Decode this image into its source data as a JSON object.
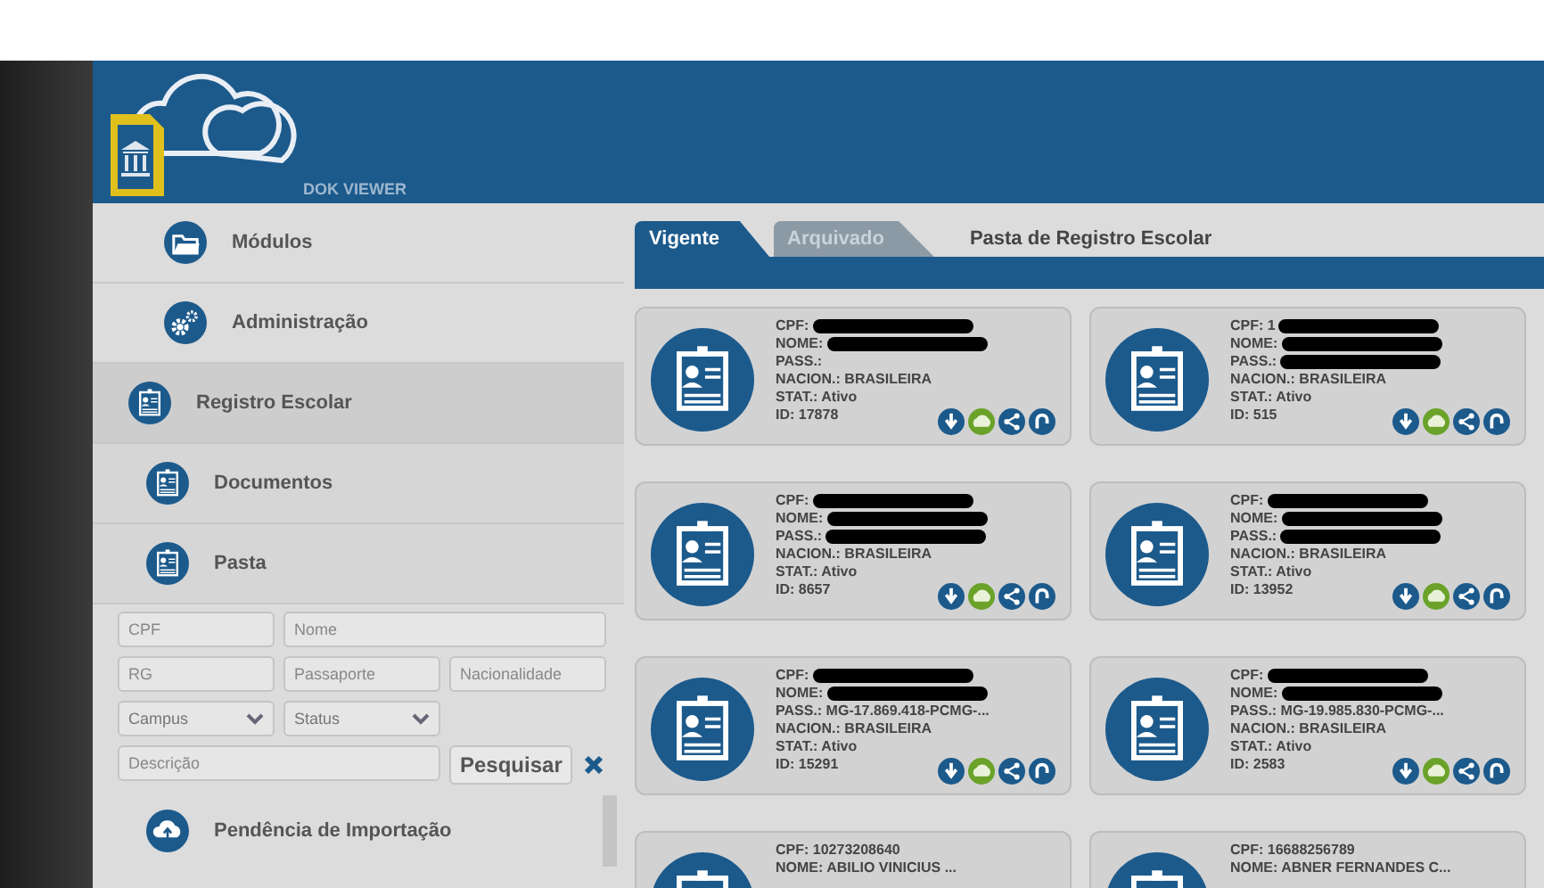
{
  "app": {
    "logo_text": "DOK VIEWER"
  },
  "sidebar": {
    "items": [
      {
        "kind": "module",
        "label": "Módulos"
      },
      {
        "kind": "module",
        "label": "Administração"
      },
      {
        "kind": "section",
        "label": "Registro Escolar",
        "children": [
          {
            "kind": "sub",
            "label": "Documentos"
          },
          {
            "kind": "sub",
            "label": "Pasta"
          }
        ]
      }
    ],
    "search": {
      "fields": [
        {
          "kind": "input",
          "placeholder": "CPF"
        },
        {
          "kind": "wide",
          "placeholder": "Nome"
        },
        {
          "kind": "input",
          "placeholder": "RG"
        },
        {
          "kind": "input",
          "placeholder": "Passaporte"
        },
        {
          "kind": "input",
          "placeholder": "Nacionalidade"
        },
        {
          "kind": "select",
          "placeholder": "Campus"
        },
        {
          "kind": "select",
          "placeholder": "Status"
        },
        {
          "kind": "wide",
          "placeholder": "Descrição"
        }
      ],
      "button": "Pesquisar"
    },
    "bottom_item": {
      "label": "Pendência de Importação"
    }
  },
  "tabs": [
    {
      "label": "Vigente",
      "selected": true
    },
    {
      "label": "Arquivado",
      "selected": false
    }
  ],
  "page_title": "Pasta de Registro Escolar",
  "cards": [
    {
      "fields": [
        {
          "label": "CPF:",
          "redacted": true
        },
        {
          "label": "NOME:",
          "redacted": true
        },
        {
          "label": "PASS.:",
          "redacted": false
        },
        {
          "label": "NACION.:",
          "value": "BRASILEIRA",
          "redacted": false
        },
        {
          "label": "STAT.:",
          "value": "Ativo",
          "redacted": false
        },
        {
          "label": "ID:",
          "value": "17878",
          "redacted": false
        }
      ]
    },
    {
      "fields": [
        {
          "label": "CPF:",
          "value": "1",
          "redacted": true
        },
        {
          "label": "NOME:",
          "redacted": true
        },
        {
          "label": "PASS.:",
          "redacted": true
        },
        {
          "label": "NACION.:",
          "value": "BRASILEIRA",
          "redacted": false
        },
        {
          "label": "STAT.:",
          "value": "Ativo",
          "redacted": false
        },
        {
          "label": "ID:",
          "value": "515",
          "redacted": false
        }
      ]
    },
    {
      "fields": [
        {
          "label": "CPF:",
          "redacted": true
        },
        {
          "label": "NOME:",
          "redacted": true
        },
        {
          "label": "PASS.:",
          "redacted": true
        },
        {
          "label": "NACION.:",
          "value": "BRASILEIRA",
          "redacted": false
        },
        {
          "label": "STAT.:",
          "value": "Ativo",
          "redacted": false
        },
        {
          "label": "ID:",
          "value": "8657",
          "redacted": false
        }
      ]
    },
    {
      "fields": [
        {
          "label": "CPF:",
          "redacted": true
        },
        {
          "label": "NOME:",
          "redacted": true
        },
        {
          "label": "PASS.:",
          "redacted": true
        },
        {
          "label": "NACION.:",
          "value": "BRASILEIRA",
          "redacted": false
        },
        {
          "label": "STAT.:",
          "value": "Ativo",
          "redacted": false
        },
        {
          "label": "ID:",
          "value": "13952",
          "redacted": false
        }
      ]
    },
    {
      "fields": [
        {
          "label": "CPF:",
          "redacted": true
        },
        {
          "label": "NOME:",
          "redacted": true
        },
        {
          "label": "PASS.:",
          "value": "MG-17.869.418-PCMG-...",
          "redacted": false
        },
        {
          "label": "NACION.:",
          "value": "BRASILEIRA",
          "redacted": false
        },
        {
          "label": "STAT.:",
          "value": "Ativo",
          "redacted": false
        },
        {
          "label": "ID:",
          "value": "15291",
          "redacted": false
        }
      ]
    },
    {
      "fields": [
        {
          "label": "CPF:",
          "redacted": true
        },
        {
          "label": "NOME:",
          "redacted": true
        },
        {
          "label": "PASS.:",
          "value": "MG-19.985.830-PCMG-...",
          "redacted": false
        },
        {
          "label": "NACION.:",
          "value": "BRASILEIRA",
          "redacted": false
        },
        {
          "label": "STAT.:",
          "value": "Ativo",
          "redacted": false
        },
        {
          "label": "ID:",
          "value": "2583",
          "redacted": false
        }
      ]
    },
    {
      "fields": [
        {
          "label": "CPF:",
          "value": "10273208640",
          "redacted": false
        },
        {
          "label": "NOME:",
          "value": "ABILIO VINICIUS ...",
          "redacted": false
        }
      ]
    },
    {
      "fields": [
        {
          "label": "CPF:",
          "value": "16688256789",
          "redacted": false
        },
        {
          "label": "NOME:",
          "value": "ABNER FERNANDES C...",
          "redacted": false
        }
      ]
    }
  ]
}
